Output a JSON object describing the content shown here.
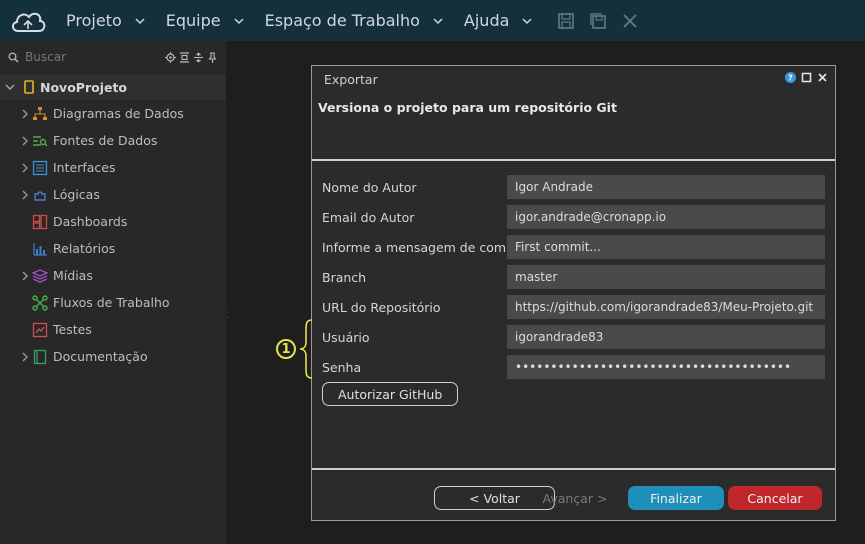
{
  "menubar": {
    "items": [
      {
        "label": "Projeto"
      },
      {
        "label": "Equipe"
      },
      {
        "label": "Espaço de Trabalho"
      },
      {
        "label": "Ajuda"
      }
    ],
    "toolbar_icons": [
      "save-icon",
      "save-all-icon",
      "close-icon"
    ]
  },
  "sidebar": {
    "search_placeholder": "Buscar",
    "project_name": "NovoProjeto",
    "items": [
      {
        "label": "Diagramas de Dados",
        "icon": "diagram-icon",
        "expandable": true,
        "color": "#e08a2c"
      },
      {
        "label": "Fontes de Dados",
        "icon": "datasource-icon",
        "expandable": true,
        "color": "#5aa84a"
      },
      {
        "label": "Interfaces",
        "icon": "interface-icon",
        "expandable": true,
        "color": "#3a8fd8"
      },
      {
        "label": "Lógicas",
        "icon": "logic-icon",
        "expandable": true,
        "color": "#4a7fd0"
      },
      {
        "label": "Dashboards",
        "icon": "dashboard-icon",
        "expandable": false,
        "color": "#d04a4a"
      },
      {
        "label": "Relatórios",
        "icon": "report-icon",
        "expandable": false,
        "color": "#3a7fd0"
      },
      {
        "label": "Mídias",
        "icon": "media-icon",
        "expandable": true,
        "color": "#a050c0"
      },
      {
        "label": "Fluxos de Trabalho",
        "icon": "workflow-icon",
        "expandable": false,
        "color": "#4ab04a"
      },
      {
        "label": "Testes",
        "icon": "test-icon",
        "expandable": false,
        "color": "#d04a5a"
      },
      {
        "label": "Documentação",
        "icon": "doc-icon",
        "expandable": true,
        "color": "#3aa060"
      }
    ]
  },
  "dialog": {
    "title": "Exportar",
    "subtitle": "Versiona o projeto para um repositório Git",
    "fields": [
      {
        "label": "Nome do Autor",
        "value": "Igor Andrade",
        "type": "text"
      },
      {
        "label": "Email do Autor",
        "value": "igor.andrade@cronapp.io",
        "type": "text"
      },
      {
        "label": "Informe a mensagem de commit",
        "value": "First commit...",
        "type": "text"
      },
      {
        "label": "Branch",
        "value": "master",
        "type": "text"
      },
      {
        "label": "URL do Repositório",
        "value": "https://github.com/igorandrade83/Meu-Projeto.git",
        "type": "text"
      },
      {
        "label": "Usuário",
        "value": "igorandrade83",
        "type": "text"
      },
      {
        "label": "Senha",
        "value": "•••••••••••••••••••••••••••••••••••••••",
        "type": "text"
      }
    ],
    "authorize_label": "Autorizar GitHub",
    "back_label": "< Voltar",
    "next_label": "Avançar >",
    "finish_label": "Finalizar",
    "cancel_label": "Cancelar"
  },
  "annotation": {
    "number": "1",
    "color": "#e6e24a"
  }
}
